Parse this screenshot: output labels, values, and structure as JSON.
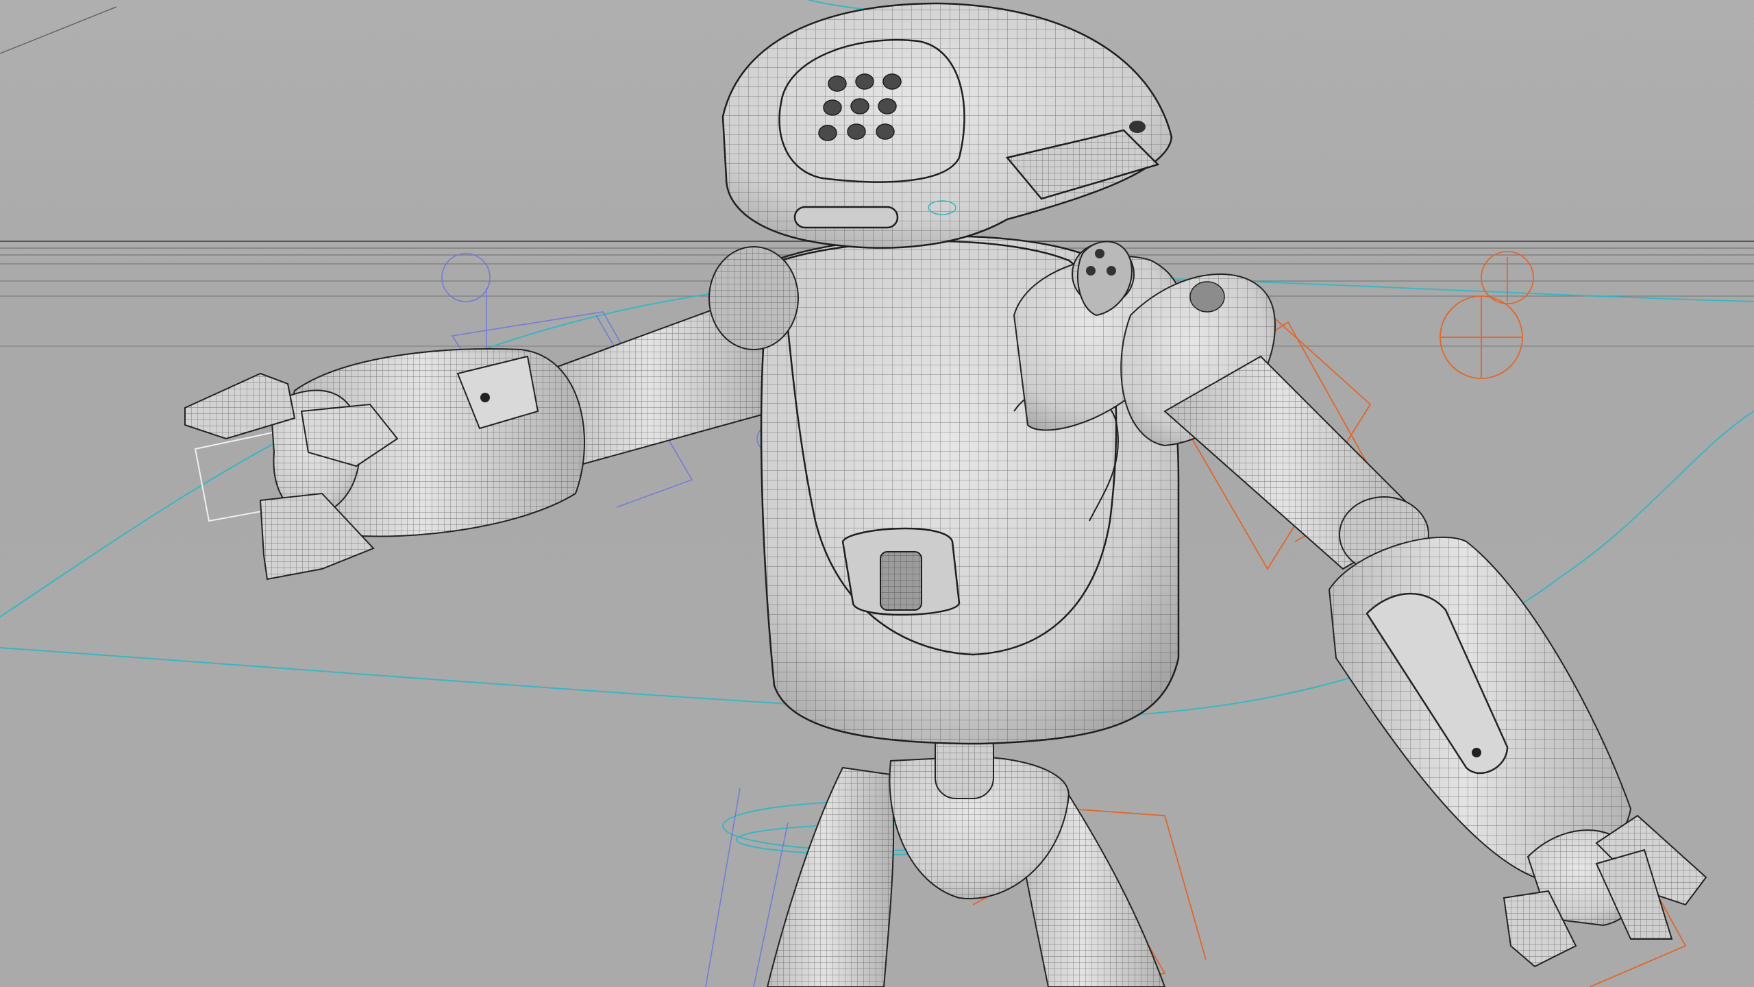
{
  "viewport": {
    "view_mode": "wireframe-on-shaded",
    "subject": "robot-character-rig",
    "colors": {
      "background": "#aaaaaa",
      "mesh_fill": "#dcdcdc",
      "mesh_wire": "#2a2a2a",
      "rig_orange": "#e0662c",
      "rig_cyan": "#2fb7c4",
      "rig_blue": "#6a74e0",
      "rig_white": "#f0f0f0"
    }
  }
}
